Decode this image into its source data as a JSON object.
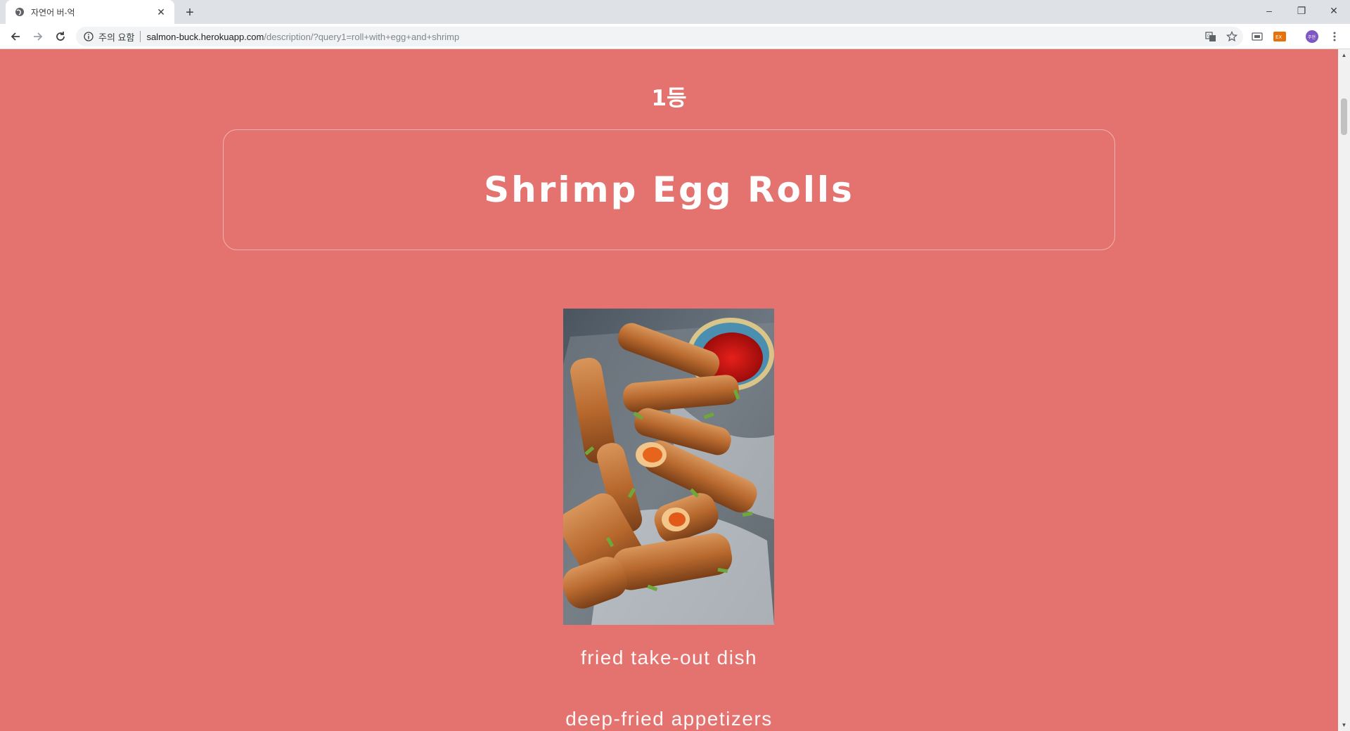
{
  "browser": {
    "tab_title": "자연어 버-억",
    "tab_close": "✕",
    "new_tab": "+",
    "security_label": "주의 요함",
    "url_host": "salmon-buck.herokuapp.com",
    "url_path": "/description/?query1=roll+with+egg+and+shrimp",
    "window_controls": {
      "minimize": "–",
      "maximize": "❐",
      "close": "✕"
    },
    "icons": [
      "globe-icon",
      "back-icon",
      "forward-icon",
      "reload-icon",
      "info-icon",
      "translate-icon",
      "star-icon",
      "cast-icon",
      "extension-icon",
      "profile-icon",
      "menu-icon"
    ],
    "profile_initials": "주현",
    "extension_label": "EX"
  },
  "page": {
    "rank": "1등",
    "dish_name": "Shrimp Egg Rolls",
    "descriptions": [
      "fried take-out dish",
      "deep-fried appetizers"
    ],
    "background_color": "#e4736f"
  }
}
